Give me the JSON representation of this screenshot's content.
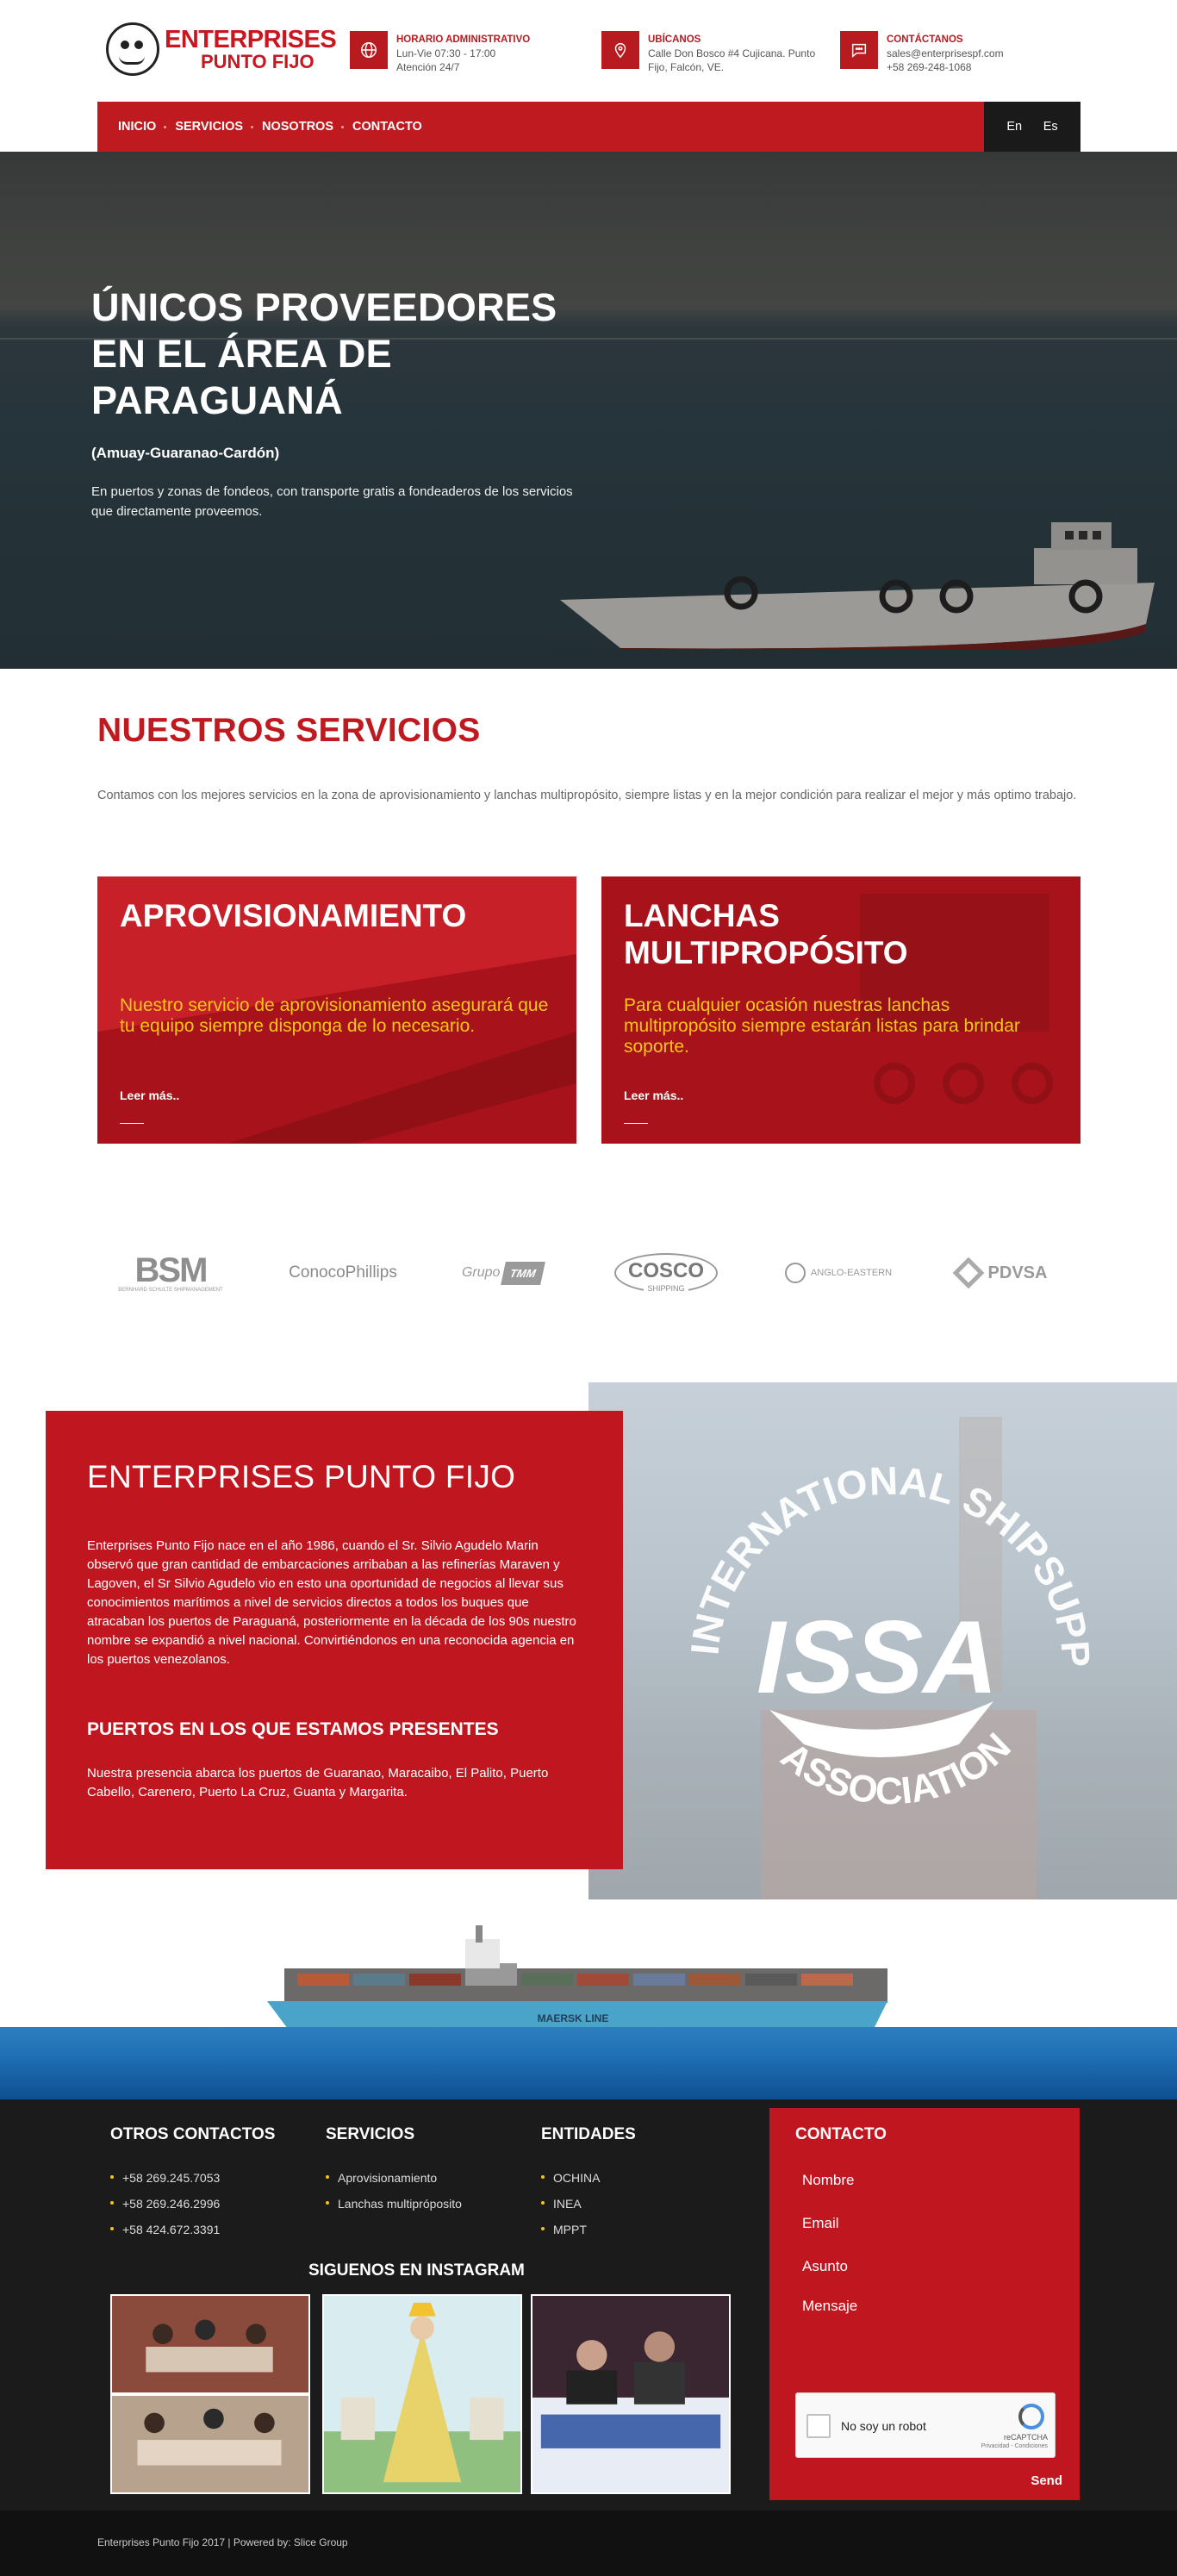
{
  "brand": {
    "line1": "ENTERPRISES",
    "line2": "PUNTO FIJO"
  },
  "header": {
    "hours": {
      "title": "HORARIO ADMINISTRATIVO",
      "line1": "Lun-Vie 07:30 - 17:00",
      "line2": "Atención 24/7"
    },
    "location": {
      "title": "UBÍCANOS",
      "line1": "Calle Don Bosco #4 Cujicana. Punto",
      "line2": "Fijo, Falcón, VE."
    },
    "contact": {
      "title": "CONTÁCTANOS",
      "line1": "sales@enterprisespf.com",
      "line2": "+58 269-248-1068"
    }
  },
  "nav": {
    "items": [
      "INICIO",
      "SERVICIOS",
      "NOSOTROS",
      "CONTACTO"
    ],
    "lang": [
      "En",
      "Es"
    ]
  },
  "hero": {
    "title": "ÚNICOS PROVEEDORES EN EL ÁREA DE PARAGUANÁ",
    "subtitle": "(Amuay-Guaranao-Cardón)",
    "description": "En puertos y zonas de fondeos, con transporte gratis a fondeaderos de los servicios que directamente proveemos."
  },
  "services": {
    "title": "NUESTROS SERVICIOS",
    "intro": "Contamos con los mejores servicios en la zona de aprovisionamiento y lanchas multipropósito, siempre listas y en la mejor condición para realizar el mejor y más optimo trabajo.",
    "cards": [
      {
        "title": "APROVISIONAMIENTO",
        "text": "Nuestro servicio de aprovisionamiento asegurará que tu equipo siempre disponga de lo necesario.",
        "more": "Leer más.."
      },
      {
        "title": "LANCHAS MULTIPROPÓSITO",
        "text": "Para cualquier ocasión nuestras lanchas multipropósito siempre estarán listas para brindar soporte.",
        "more": "Leer más.."
      }
    ]
  },
  "partners": [
    {
      "name": "BSM",
      "sub": "BERNHARD SCHULTE SHIPMANAGEMENT"
    },
    {
      "name": "ConocoPhillips"
    },
    {
      "name": "Grupo",
      "badge": "TMM"
    },
    {
      "name": "COSCO",
      "sub": "SHIPPING"
    },
    {
      "name": "ANGLO-EASTERN"
    },
    {
      "name": "PDVSA"
    }
  ],
  "about": {
    "title": "ENTERPRISES PUNTO FIJO",
    "text": "Enterprises Punto Fijo nace en el año 1986, cuando el Sr. Silvio Agudelo Marin observó que gran cantidad de embarcaciones arribaban a las refinerías Maraven y Lagoven, el Sr Silvio Agudelo vio en esto una oportunidad de negocios al llevar sus conocimientos marítimos a nivel de servicios directos a todos los buques que atracaban los puertos de Paraguaná, posteriormente en la década de los 90s nuestro nombre se expandió a nivel nacional. Convirtiéndonos en una reconocida agencia en los puertos venezolanos.",
    "ports_title": "PUERTOS EN LOS QUE ESTAMOS PRESENTES",
    "ports_text": "Nuestra presencia abarca los puertos de Guaranao, Maracaibo, El Palito, Puerto Cabello, Carenero, Puerto La Cruz, Guanta y Margarita.",
    "issa_top": "INTERNATIONAL SHIPSUPPLIERS & SERVICES",
    "issa_mid": "ISSA",
    "issa_bottom": "ASSOCIATION"
  },
  "ship": {
    "label": "MAERSK LINE"
  },
  "footer": {
    "contacts": {
      "title": "OTROS CONTACTOS",
      "items": [
        "+58 269.245.7053",
        "+58 269.246.2996",
        "+58 424.672.3391"
      ]
    },
    "services": {
      "title": "SERVICIOS",
      "items": [
        "Aprovisionamiento",
        "Lanchas multipróposito"
      ]
    },
    "entities": {
      "title": "ENTIDADES",
      "items": [
        "OCHINA",
        "INEA",
        "MPPT"
      ]
    },
    "instagram_title": "SIGUENOS EN INSTAGRAM",
    "form": {
      "title": "CONTACTO",
      "fields": [
        "Nombre",
        "Email",
        "Asunto",
        "Mensaje"
      ],
      "captcha_label": "No soy un robot",
      "captcha_brand": "reCAPTCHA",
      "captcha_links": "Privacidad - Condiciones",
      "send": "Send"
    },
    "copyright": "Enterprises Punto Fijo 2017 | Powered by: Slice Group"
  },
  "colors": {
    "brand_red": "#be1a20",
    "accent_yellow": "#f5c518",
    "footer_dark": "#1b1b1b"
  }
}
